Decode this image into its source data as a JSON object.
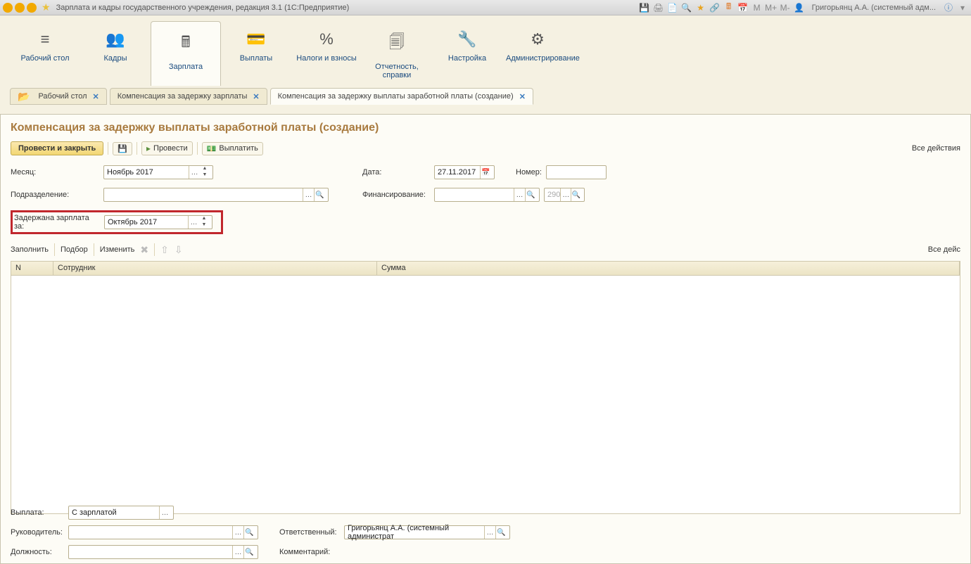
{
  "title": {
    "app": "Зарплата и кадры государственного учреждения, редакция 3.1  (1С:Предприятие)",
    "user": "Григорьянц А.А. (системный адм...",
    "m_labels": [
      "M",
      "M+",
      "M-"
    ]
  },
  "nav": [
    {
      "icon": "≡",
      "label": "Рабочий стол"
    },
    {
      "icon": "👥",
      "label": "Кадры"
    },
    {
      "icon": "🖩",
      "label": "Зарплата"
    },
    {
      "icon": "💳",
      "label": "Выплаты"
    },
    {
      "icon": "%",
      "label": "Налоги и взносы"
    },
    {
      "icon": "🗐",
      "label": "Отчетность, справки"
    },
    {
      "icon": "🔧",
      "label": "Настройка"
    },
    {
      "icon": "⚙",
      "label": "Администрирование"
    }
  ],
  "tabs": [
    {
      "label": "Рабочий стол",
      "desktop": true
    },
    {
      "label": "Компенсация за задержку зарплаты"
    },
    {
      "label": "Компенсация за задержку выплаты заработной платы (создание)",
      "active": true
    }
  ],
  "page": {
    "heading": "Компенсация за задержку выплаты заработной платы (создание)",
    "toolbar": {
      "main": "Провести и закрыть",
      "provesti": "Провести",
      "vyplatit": "Выплатить",
      "all": "Все действия"
    },
    "form": {
      "month_label": "Месяц:",
      "month_value": "Ноябрь 2017",
      "date_label": "Дата:",
      "date_value": "27.11.2017",
      "number_label": "Номер:",
      "number_value": "",
      "subdiv_label": "Подразделение:",
      "fin_label": "Финансирование:",
      "fin_small": "290",
      "delayed_label": "Задержана зарплата за:",
      "delayed_value": "Октябрь 2017"
    },
    "subtoolbar": {
      "fill": "Заполнить",
      "select": "Подбор",
      "edit": "Изменить",
      "all": "Все дейс"
    },
    "grid": {
      "columns": [
        "N",
        "Сотрудник",
        "Сумма"
      ]
    },
    "footer": {
      "pay_label": "Выплата:",
      "pay_value": "С зарплатой",
      "head_label": "Руководитель:",
      "resp_label": "Ответственный:",
      "resp_value": "Григорьянц А.А. (системный администрат",
      "post_label": "Должность:",
      "comment_label": "Комментарий:"
    }
  }
}
